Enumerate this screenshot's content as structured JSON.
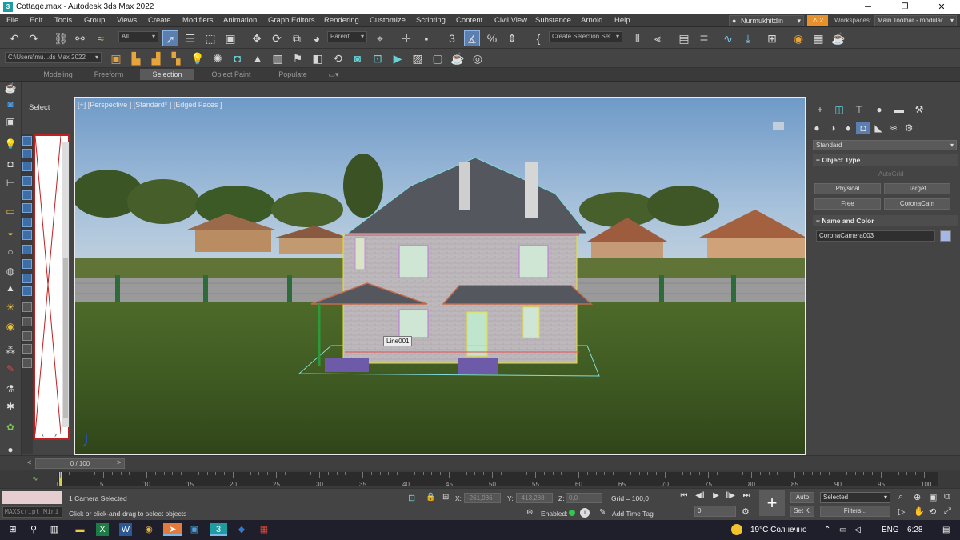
{
  "window": {
    "title": "Cottage.max - Autodesk 3ds Max 2022",
    "controls": [
      "─",
      "❐",
      "✕"
    ]
  },
  "menu": [
    "File",
    "Edit",
    "Tools",
    "Group",
    "Views",
    "Create",
    "Modifiers",
    "Animation",
    "Graph Editors",
    "Rendering",
    "Customize",
    "Scripting",
    "Content",
    "Civil View",
    "Substance",
    "Arnold",
    "Help"
  ],
  "account": {
    "user": "Nurmukhitdin",
    "warnings": "2",
    "workspaces_label": "Workspaces:",
    "workspace": "Main Toolbar - modular"
  },
  "toolbar": {
    "selection_filter": "All",
    "reference_coord": "Parent",
    "named_selection": "Create Selection Set",
    "project_path": "C:\\Users\\mu...ds Max 2022"
  },
  "ribbon_tabs": [
    "Modeling",
    "Freeform",
    "Selection",
    "Object Paint",
    "Populate"
  ],
  "ribbon_active": "Selection",
  "explorer": {
    "label": "Select"
  },
  "viewport": {
    "label": "[+] [Perspective ] [Standard* ] [Edged Faces ]",
    "tooltip": "Line001"
  },
  "command_panel": {
    "category": "Standard",
    "object_type_title": "Object Type",
    "autogrid": "AutoGrid",
    "buttons": [
      "Physical",
      "Target",
      "Free",
      "CoronaCam"
    ],
    "name_color_title": "Name and Color",
    "object_name": "CoronaCamera003",
    "object_color": "#a3b7e8"
  },
  "timeline": {
    "frame_display": "0 / 100",
    "ticks": [
      "0",
      "5",
      "10",
      "15",
      "20",
      "25",
      "30",
      "35",
      "40",
      "45",
      "50",
      "55",
      "60",
      "65",
      "70",
      "75",
      "80",
      "85",
      "90",
      "95",
      "100"
    ]
  },
  "status": {
    "maxscript": "MAXScript Mini",
    "selection": "1 Camera Selected",
    "prompt": "Click or click-and-drag to select objects",
    "x_label": "X:",
    "x_value": "-261,936",
    "y_label": "Y:",
    "y_value": "-413,288",
    "z_label": "Z:",
    "z_value": "0,0",
    "grid": "Grid = 100,0",
    "enabled": "Enabled:",
    "add_time_tag": "Add Time Tag",
    "frame": "0",
    "auto": "Auto",
    "set_key": "Set K.",
    "key_filter": "Selected",
    "filters": "Filters..."
  },
  "taskbar": {
    "weather": "19°C  Солнечно",
    "lang": "ENG",
    "time": "6:28"
  }
}
